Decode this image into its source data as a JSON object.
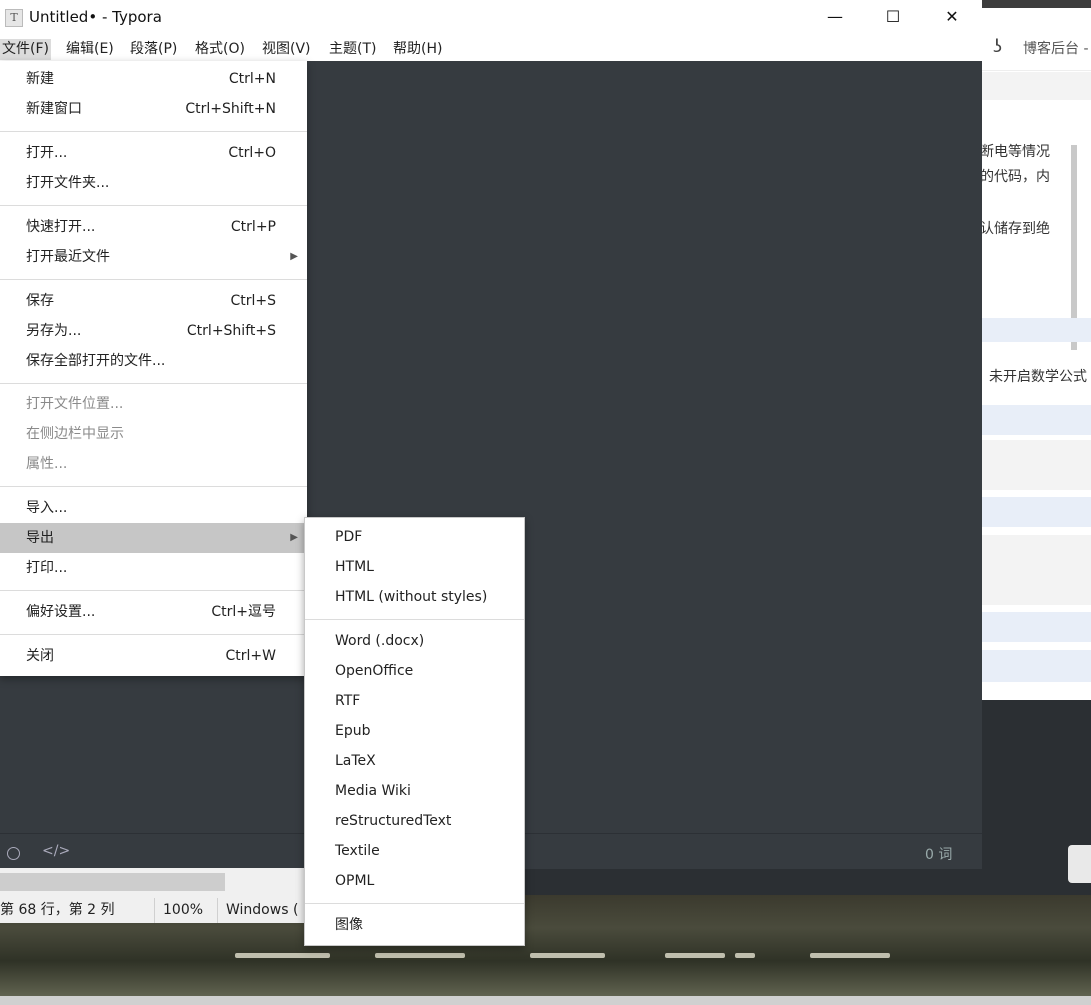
{
  "window": {
    "title": "Untitled• - Typora",
    "icon_letter": "T",
    "controls": [
      "—",
      "☐",
      "✕"
    ]
  },
  "menubar": [
    "文件(F)",
    "编辑(E)",
    "段落(P)",
    "格式(O)",
    "视图(V)",
    "主题(T)",
    "帮助(H)"
  ],
  "file_menu": {
    "groups": [
      [
        {
          "label": "新建",
          "shortcut": "Ctrl+N"
        },
        {
          "label": "新建窗口",
          "shortcut": "Ctrl+Shift+N"
        }
      ],
      [
        {
          "label": "打开...",
          "shortcut": "Ctrl+O"
        },
        {
          "label": "打开文件夹...",
          "shortcut": ""
        }
      ],
      [
        {
          "label": "快速打开...",
          "shortcut": "Ctrl+P"
        },
        {
          "label": "打开最近文件",
          "shortcut": "",
          "submenu": true
        }
      ],
      [
        {
          "label": "保存",
          "shortcut": "Ctrl+S"
        },
        {
          "label": "另存为...",
          "shortcut": "Ctrl+Shift+S"
        },
        {
          "label": "保存全部打开的文件...",
          "shortcut": ""
        }
      ],
      [
        {
          "label": "打开文件位置...",
          "shortcut": "",
          "disabled": true
        },
        {
          "label": "在侧边栏中显示",
          "shortcut": "",
          "disabled": true
        },
        {
          "label": "属性...",
          "shortcut": "",
          "disabled": true
        }
      ],
      [
        {
          "label": "导入...",
          "shortcut": ""
        },
        {
          "label": "导出",
          "shortcut": "",
          "submenu": true,
          "highlighted": true
        },
        {
          "label": "打印...",
          "shortcut": ""
        }
      ],
      [
        {
          "label": "偏好设置...",
          "shortcut": "Ctrl+逗号"
        }
      ],
      [
        {
          "label": "关闭",
          "shortcut": "Ctrl+W"
        }
      ]
    ]
  },
  "export_menu": {
    "groups": [
      [
        "PDF",
        "HTML",
        "HTML (without styles)"
      ],
      [
        "Word (.docx)",
        "OpenOffice",
        "RTF",
        "Epub",
        "LaTeX",
        "Media Wiki",
        "reStructuredText",
        "Textile",
        "OPML"
      ],
      [
        "图像"
      ]
    ]
  },
  "footer": {
    "word_count": "0 词"
  },
  "statusbar": {
    "position": "第 68 行，第 2 列",
    "zoom": "100%",
    "line_ending": "Windows ("
  },
  "bg_window": {
    "header_text": "博客后台 -",
    "lines": [
      "断电等情况",
      "的代码，内",
      "认储存到绝",
      "。未开启数学公式"
    ]
  }
}
